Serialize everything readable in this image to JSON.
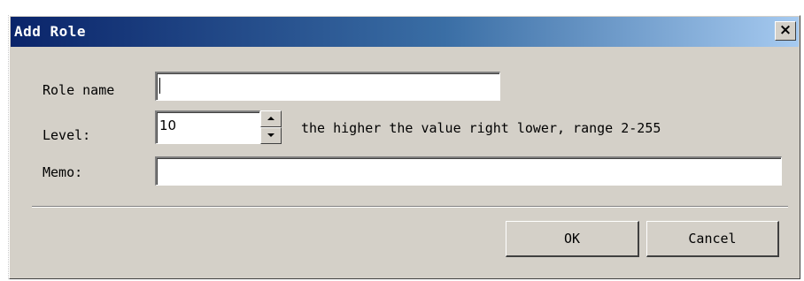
{
  "dialog": {
    "title": "Add Role",
    "close_glyph": "×"
  },
  "form": {
    "role_name_label": "Role name",
    "role_name_value": "",
    "level_label": "Level:",
    "level_value": "10",
    "level_hint": "the higher the value right lower, range 2-255",
    "memo_label": "Memo:",
    "memo_value": ""
  },
  "buttons": {
    "ok_label": "OK",
    "cancel_label": "Cancel"
  },
  "icons": [
    "close-icon",
    "spin-up-icon",
    "spin-down-icon"
  ]
}
